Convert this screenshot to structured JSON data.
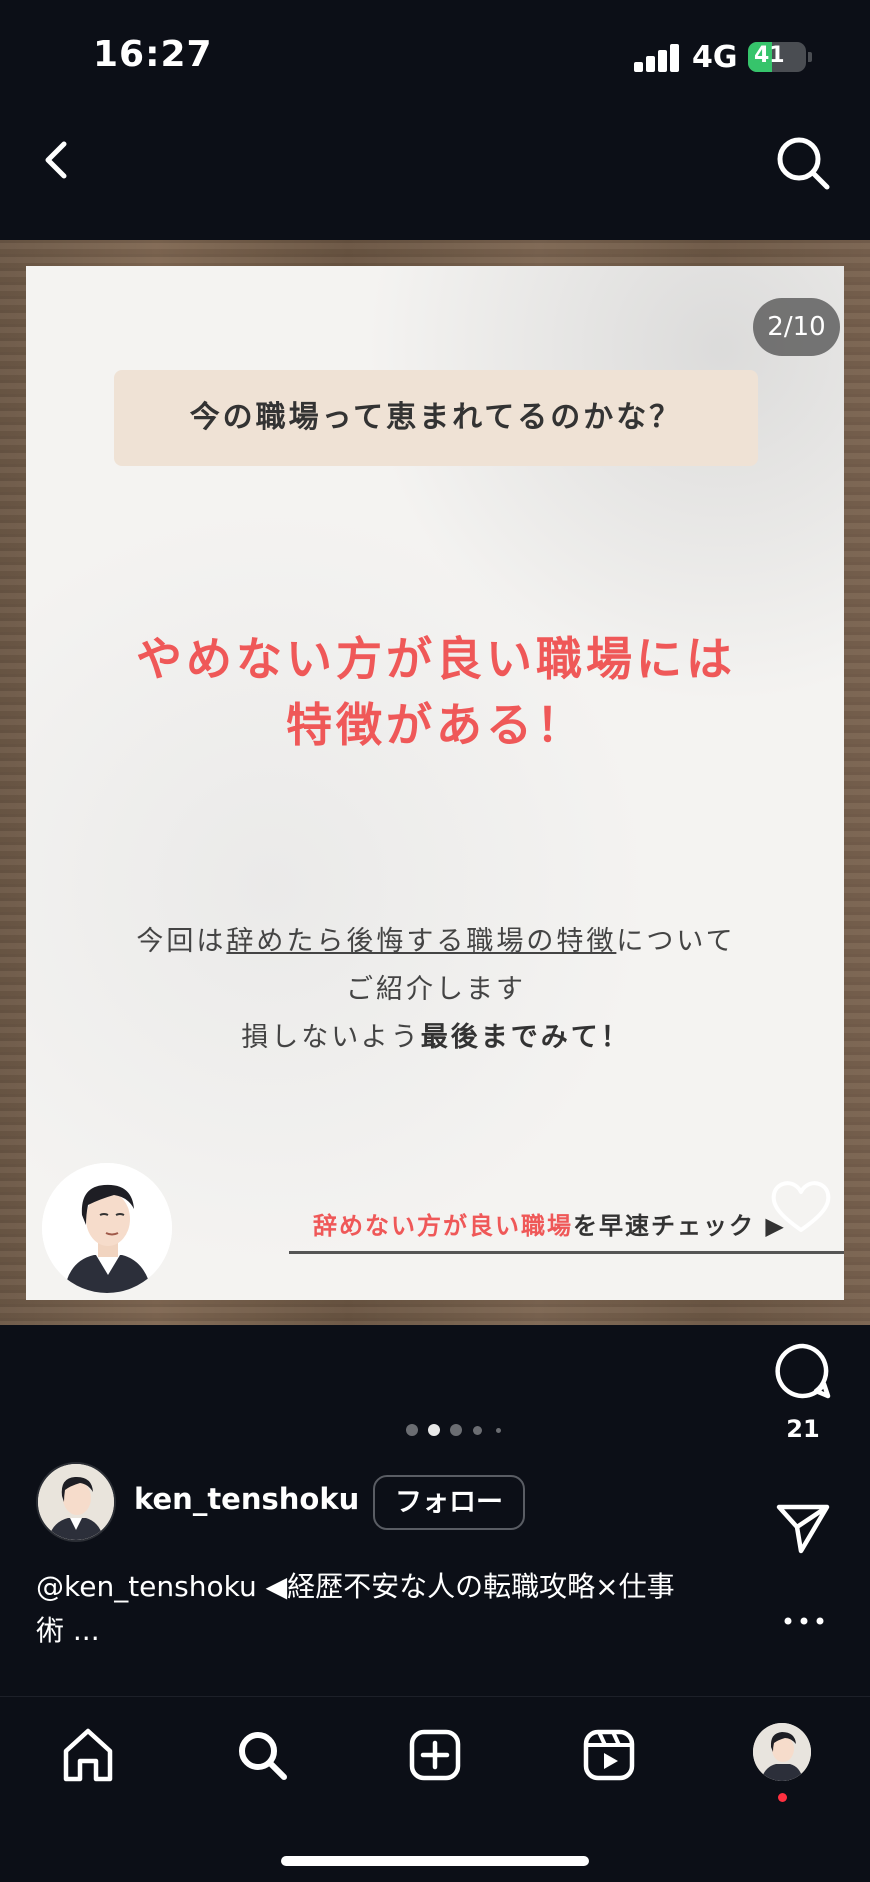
{
  "status_bar": {
    "time": "16:27",
    "network": "4G",
    "battery": "41",
    "battery_level": 0.41,
    "battery_color": "#36c46b"
  },
  "nav": {
    "back_icon": "chevron-left-icon",
    "search_icon": "search-icon"
  },
  "slide": {
    "counter": "2/10",
    "question": "今の職場って恵まれてるのかな？",
    "headline_line1": "やめない方が良い職場には",
    "headline_line2": "特徴がある！",
    "body_prefix": "今回は",
    "body_underlined": "辞めたら後悔する職場の特徴",
    "body_suffix": "について",
    "body_line2": "ご紹介します",
    "body_line3_prefix": "損しないよう",
    "body_line3_bold": "最後までみて！",
    "cta_red": "辞めない方が良い職場",
    "cta_rest": "を早速チェック ▶",
    "accent_color": "#ef5858"
  },
  "actions": {
    "like_icon": "heart-icon",
    "comment_icon": "comment-icon",
    "comment_count": "21",
    "share_icon": "paper-plane-icon",
    "more_icon": "more-icon"
  },
  "carousel": {
    "active_index": 1,
    "dot_count": 5
  },
  "author": {
    "username": "ken_tenshoku",
    "follow_label": "フォロー"
  },
  "caption": {
    "line1": "@ken_tenshoku ◀経歴不安な人の転職攻略×仕事",
    "line2": "術 ..."
  },
  "tab_bar": {
    "items": [
      "home-icon",
      "search-icon",
      "create-icon",
      "reels-icon",
      "profile-avatar"
    ]
  }
}
